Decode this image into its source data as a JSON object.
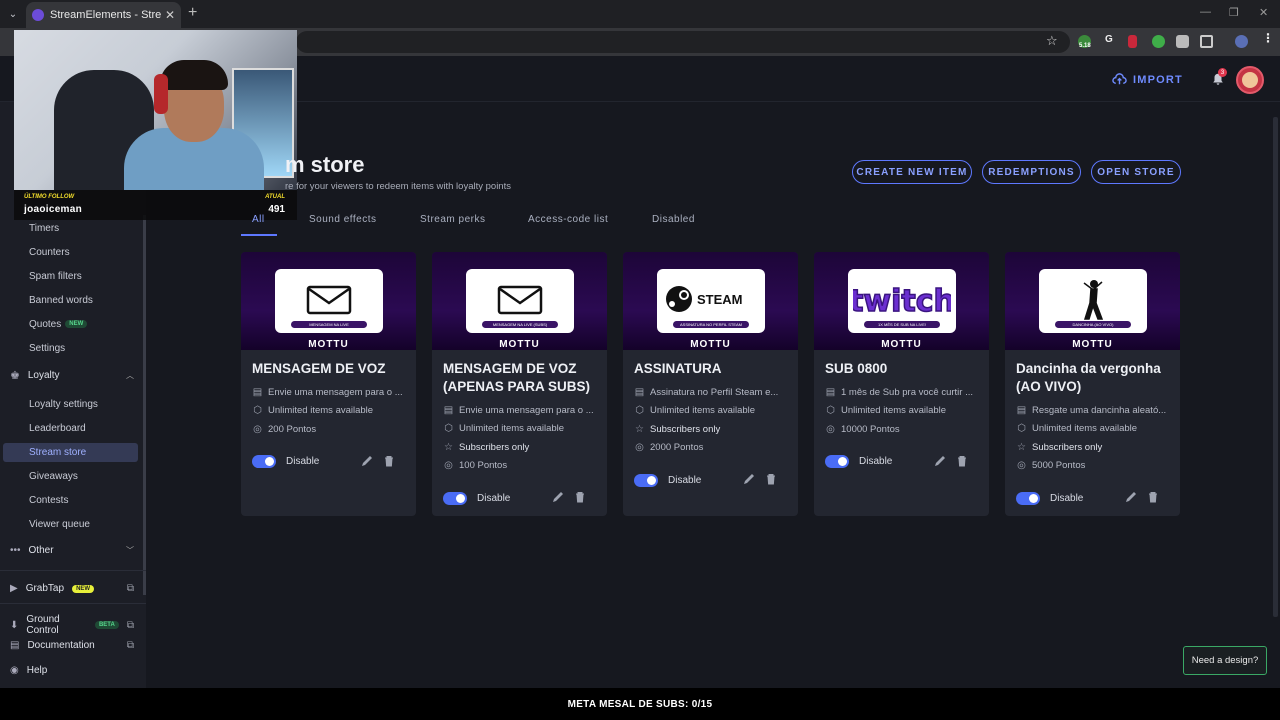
{
  "browser": {
    "tab_title": "StreamElements - Stream store",
    "ext_badge": "5.18"
  },
  "header": {
    "import_label": "IMPORT",
    "notif_count": "3"
  },
  "webcam": {
    "follow_label": "ÚLTIMO FOLLOW",
    "follow_name": "joaoiceman",
    "atual_label": "ATUAL",
    "atual_value": "491"
  },
  "sidebar": {
    "items": [
      {
        "label": "Timers"
      },
      {
        "label": "Counters"
      },
      {
        "label": "Spam filters"
      },
      {
        "label": "Banned words"
      },
      {
        "label": "Quotes",
        "badge": "NEW"
      },
      {
        "label": "Settings"
      }
    ],
    "loyalty_section": "Loyalty",
    "loyalty_items": [
      {
        "label": "Loyalty settings"
      },
      {
        "label": "Leaderboard"
      },
      {
        "label": "Stream store",
        "active": true
      },
      {
        "label": "Giveaways"
      },
      {
        "label": "Contests"
      },
      {
        "label": "Viewer queue"
      }
    ],
    "other_section": "Other",
    "grabtap": "GrabTap",
    "grabtap_badge": "NEW",
    "ground_control": "Ground Control",
    "ground_control_badge": "BETA",
    "documentation": "Documentation",
    "help": "Help"
  },
  "page": {
    "title": "m store",
    "subtitle": "re for your viewers to redeem items with loyalty points",
    "buttons": {
      "create": "CREATE NEW ITEM",
      "redemptions": "REDEMPTIONS",
      "open_store": "OPEN STORE"
    },
    "tabs": [
      "All",
      "Sound effects",
      "Stream perks",
      "Access-code list",
      "Disabled"
    ]
  },
  "cards": [
    {
      "title": "MENSAGEM DE VOZ",
      "image_caption": "MENSAGEM NA LIVE",
      "description": "Envie uma mensagem para o ...",
      "availability": "Unlimited items available",
      "subs_only": "",
      "cost": "200 Pontos",
      "toggle_label": "Disable",
      "icon": "envelope-icon"
    },
    {
      "title": "MENSAGEM DE VOZ (APENAS PARA SUBS)",
      "image_caption": "MENSAGEM NA LIVE (SUBS)",
      "description": "Envie uma mensagem para o ...",
      "availability": "Unlimited items available",
      "subs_only": "Subscribers only",
      "cost": "100 Pontos",
      "toggle_label": "Disable",
      "icon": "envelope-icon"
    },
    {
      "title": "ASSINATURA",
      "image_caption": "ASSINATURA NO PERFIL STEAM",
      "description": "Assinatura no Perfil Steam e...",
      "availability": "Unlimited items available",
      "subs_only": "Subscribers only",
      "cost": "2000 Pontos",
      "toggle_label": "Disable",
      "icon": "steam-logo-icon",
      "logo_text": "STEAM"
    },
    {
      "title": "SUB 0800",
      "image_caption": "1X MÊS DE SUB NA LIVE!",
      "description": "1 mês de Sub pra você curtir ...",
      "availability": "Unlimited items available",
      "subs_only": "",
      "cost": "10000 Pontos",
      "toggle_label": "Disable",
      "icon": "twitch-logo-icon",
      "logo_text": "twitch"
    },
    {
      "title": "Dancinha da vergonha (AO VIVO)",
      "image_caption": "DANCINHA (AO VIVO)",
      "description": "Resgate uma dancinha aleató...",
      "availability": "Unlimited items available",
      "subs_only": "Subscribers only",
      "cost": "5000 Pontos",
      "toggle_label": "Disable",
      "icon": "dancer-icon"
    }
  ],
  "card_brand": "MOTTU",
  "footer": {
    "goal_text": "META MESAL DE SUBS: 0/15",
    "need_design": "Need a design?"
  },
  "colors": {
    "accent": "#5e78ff",
    "background": "#16181f",
    "card": "#232630",
    "card_image": "#2b0a52"
  }
}
